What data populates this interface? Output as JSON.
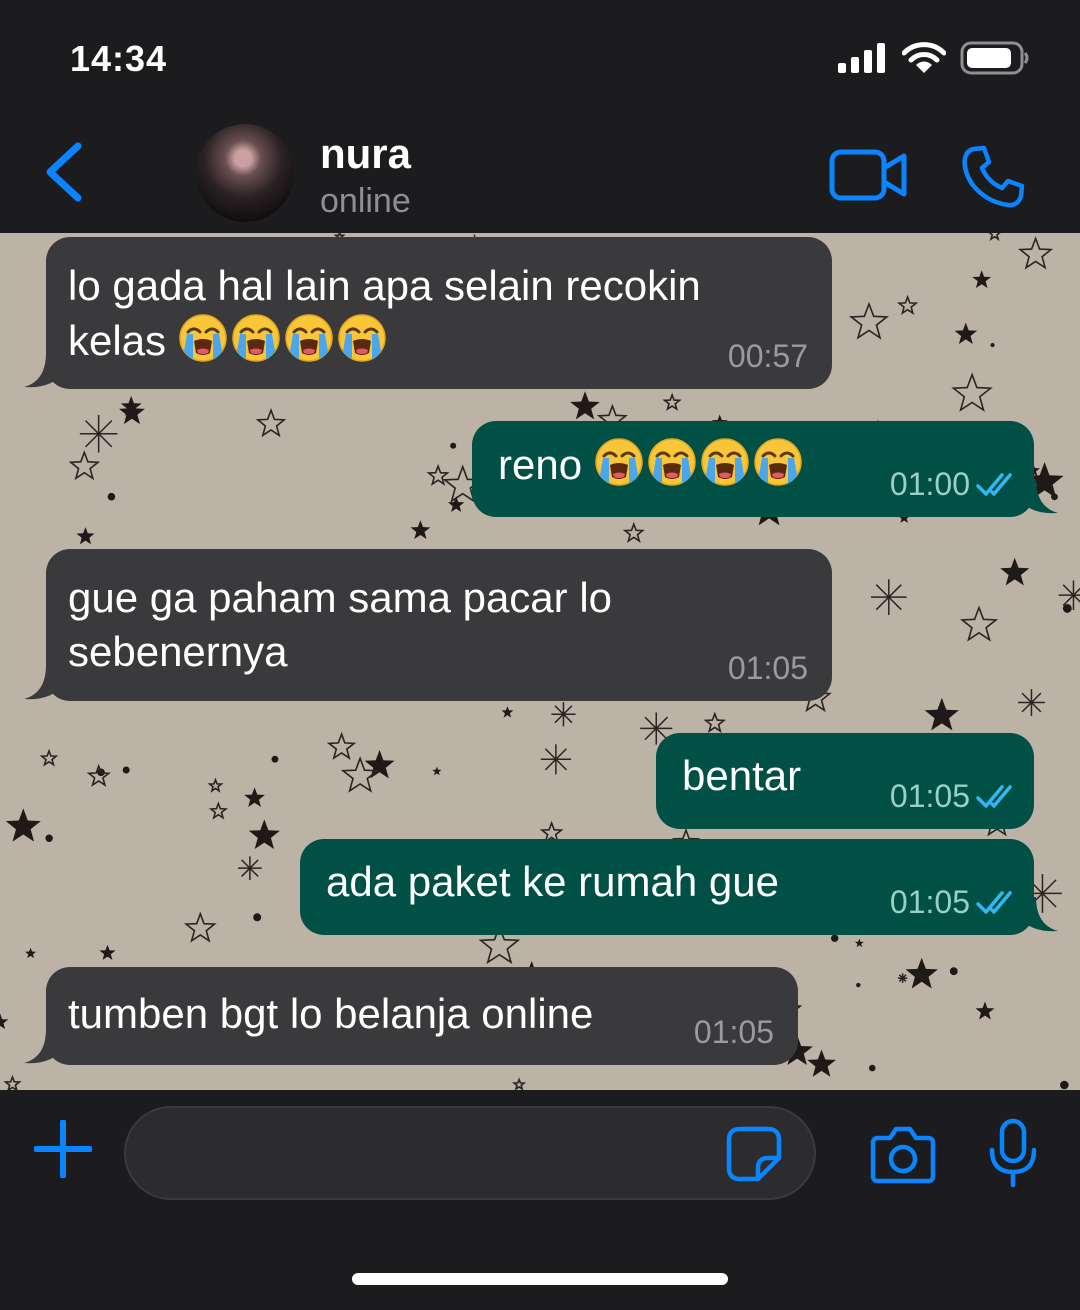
{
  "status_bar": {
    "time": "14:34"
  },
  "header": {
    "name": "nura",
    "status": "online"
  },
  "messages": [
    {
      "dir": "in",
      "text": "lo gada hal lain apa selain recokin\nkelas ",
      "emoji_count": 4,
      "time": "00:57"
    },
    {
      "dir": "out",
      "text": "reno ",
      "emoji_count": 4,
      "time": "01:00",
      "read": true
    },
    {
      "dir": "in",
      "text": "gue ga paham sama pacar lo\nsebenernya",
      "time": "01:05"
    },
    {
      "dir": "out",
      "text": "bentar",
      "time": "01:05",
      "read": true
    },
    {
      "dir": "out",
      "text": "ada paket ke rumah gue",
      "time": "01:05",
      "read": true
    },
    {
      "dir": "in",
      "text": "tumben bgt lo belanja online",
      "time": "01:05"
    }
  ],
  "emoji": {
    "name": "loudly-crying-face"
  },
  "input": {
    "placeholder": ""
  },
  "icons": {
    "back": "chevron-left-icon",
    "video": "video-camera-icon",
    "call": "phone-icon",
    "plus": "plus-icon",
    "sticker": "sticker-icon",
    "camera": "camera-icon",
    "mic": "microphone-icon",
    "read": "double-check-icon"
  },
  "colors": {
    "accent": "#0a84ff",
    "bubble_in": "#3a3a3c",
    "bubble_out": "#005046",
    "read_tick": "#34b7f1",
    "wallpaper": "#bcb2a6"
  }
}
